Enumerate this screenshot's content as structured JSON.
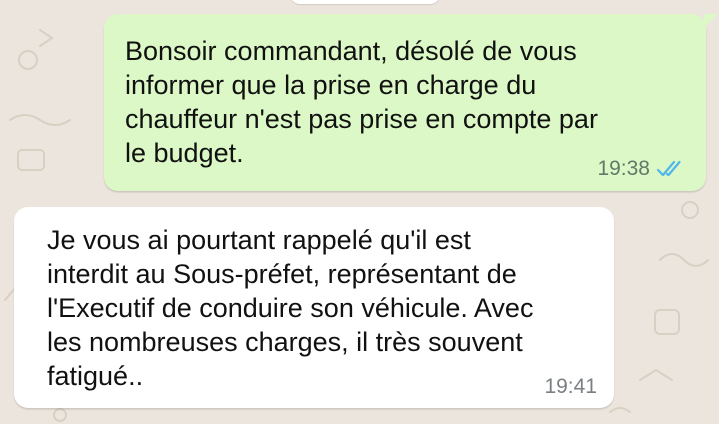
{
  "chat": {
    "messages": [
      {
        "direction": "outgoing",
        "text": "Bonsoir commandant,  désolé de vous\ninformer que la prise en charge du\nchauffeur n'est pas prise en compte par\nle budget.",
        "time": "19:38",
        "status": "read",
        "status_icon": "double-check-icon",
        "status_color": "#4fb6ec"
      },
      {
        "direction": "incoming",
        "text": "Je vous ai pourtant rappelé qu'il est\ninterdit au Sous-préfet,  représentant de\nl'Executif de conduire son véhicule.  Avec\nles nombreuses charges, il très souvent\nfatigué..",
        "time": "19:41"
      }
    ]
  },
  "theme": {
    "wallpaper_color": "#ece5dd",
    "outgoing_bubble_color": "#dcf8c6",
    "incoming_bubble_color": "#ffffff"
  }
}
